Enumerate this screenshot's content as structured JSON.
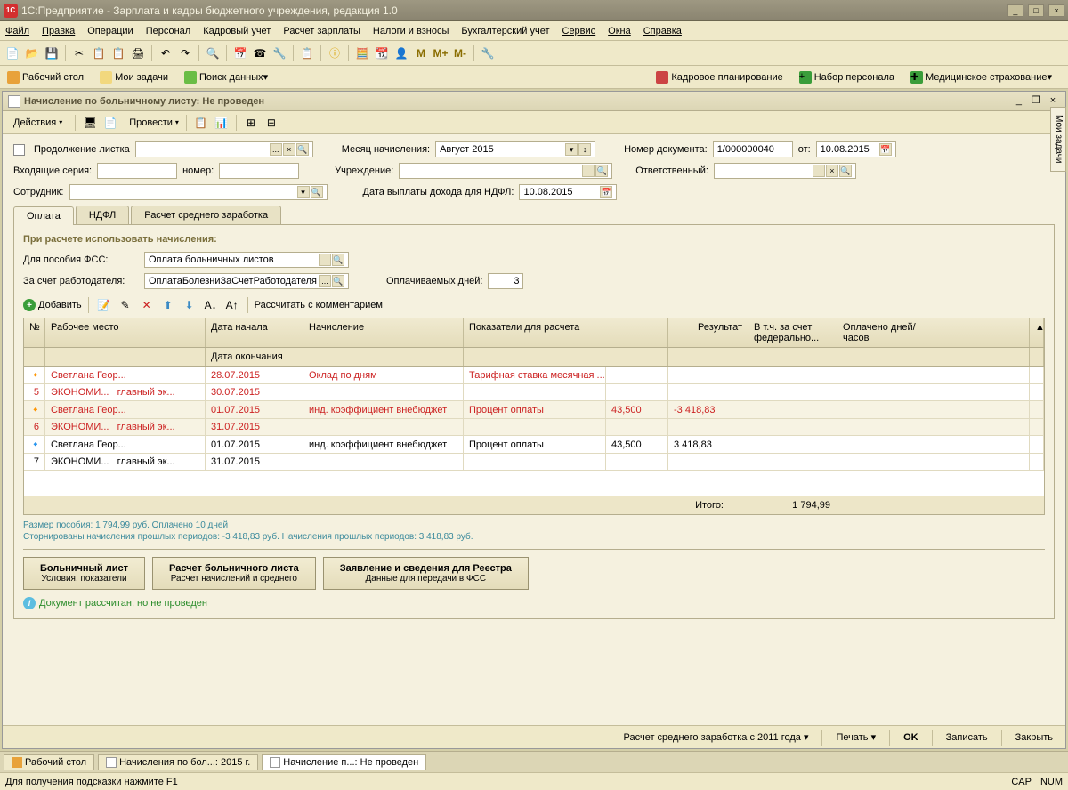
{
  "app": {
    "title": "1С:Предприятие - Зарплата и кадры бюджетного учреждения, редакция 1.0"
  },
  "menu": [
    "Файл",
    "Правка",
    "Операции",
    "Персонал",
    "Кадровый учет",
    "Расчет зарплаты",
    "Налоги и взносы",
    "Бухгалтерский учет",
    "Сервис",
    "Окна",
    "Справка"
  ],
  "nav": {
    "desktop": "Рабочий стол",
    "tasks": "Мои задачи",
    "search": "Поиск данных",
    "planning": "Кадровое планирование",
    "recruit": "Набор персонала",
    "medical": "Медицинское страхование"
  },
  "doc": {
    "title": "Начисление по больничному листу: Не проведен",
    "actions": "Действия",
    "conduct": "Провести",
    "continuation_label": "Продолжение листка",
    "incoming_series": "Входящие серия:",
    "number_label": "номер:",
    "employee_label": "Сотрудник:",
    "month_label": "Месяц начисления:",
    "month_value": "Август 2015",
    "org_label": "Учреждение:",
    "ndfl_date_label": "Дата выплаты дохода для НДФЛ:",
    "ndfl_date_value": "10.08.2015",
    "docnum_label": "Номер документа:",
    "docnum_value": "1/000000040",
    "docdate_label": "от:",
    "docdate_value": "10.08.2015",
    "resp_label": "Ответственный:"
  },
  "tabs": {
    "payment": "Оплата",
    "ndfl": "НДФЛ",
    "avg": "Расчет среднего заработка"
  },
  "section": {
    "title": "При расчете использовать начисления:",
    "fss_label": "Для пособия ФСС:",
    "fss_value": "Оплата больничных листов",
    "emp_label": "За счет работодателя:",
    "emp_value": "ОплатаБолезниЗаСчетРаботодателя",
    "days_label": "Оплачиваемых дней:",
    "days_value": "3"
  },
  "grid_toolbar": {
    "add": "Добавить",
    "calc": "Рассчитать с комментарием"
  },
  "grid_headers": {
    "n": "№",
    "place": "Рабочее место",
    "date_start": "Дата начала",
    "date_end": "Дата окончания",
    "accrual": "Начисление",
    "indicators": "Показатели для расчета",
    "result": "Результат",
    "federal": "В т.ч. за счет федерально...",
    "paid": "Оплачено дней/часов"
  },
  "rows": [
    {
      "n": "5",
      "name": "Светлана Геор...",
      "dept": "ЭКОНОМИ...",
      "pos": "главный эк...",
      "d1": "28.07.2015",
      "d2": "30.07.2015",
      "accr": "Оклад по дням",
      "ind": "Тарифная ставка месячная ...",
      "indv": "",
      "res": "",
      "red": true
    },
    {
      "n": "6",
      "name": "Светлана Геор...",
      "dept": "ЭКОНОМИ...",
      "pos": "главный эк...",
      "d1": "01.07.2015",
      "d2": "31.07.2015",
      "accr": "инд. коэффициент внебюджет",
      "ind": "Процент оплаты",
      "indv": "43,500",
      "res": "-3 418,83",
      "red": true
    },
    {
      "n": "7",
      "name": "Светлана Геор...",
      "dept": "ЭКОНОМИ...",
      "pos": "главный эк...",
      "d1": "01.07.2015",
      "d2": "31.07.2015",
      "accr": "инд. коэффициент внебюджет",
      "ind": "Процент оплаты",
      "indv": "43,500",
      "res": "3 418,83",
      "red": false
    }
  ],
  "totals": {
    "label": "Итого:",
    "value": "1 794,99"
  },
  "info1": "Размер пособия: 1 794,99 руб. Оплачено 10 дней",
  "info2": "Сторнированы начисления прошлых периодов: -3 418,83 руб. Начисления прошлых периодов: 3 418,83 руб.",
  "bigbtns": {
    "b1t": "Больничный лист",
    "b1s": "Условия, показатели",
    "b2t": "Расчет больничного листа",
    "b2s": "Расчет начислений и среднего",
    "b3t": "Заявление и сведения для Реестра",
    "b3s": "Данные для передачи в ФСС"
  },
  "status_msg": "Документ рассчитан, но не проведен",
  "footer": {
    "avg": "Расчет среднего заработка с 2011 года",
    "print": "Печать",
    "ok": "OK",
    "save": "Записать",
    "close": "Закрыть"
  },
  "side": "Мои задачи",
  "taskbar": {
    "t1": "Рабочий стол",
    "t2": "Начисления по бол...: 2015 г.",
    "t3": "Начисление п...: Не проведен"
  },
  "statusbar": {
    "hint": "Для получения подсказки нажмите F1",
    "cap": "CAP",
    "num": "NUM"
  }
}
